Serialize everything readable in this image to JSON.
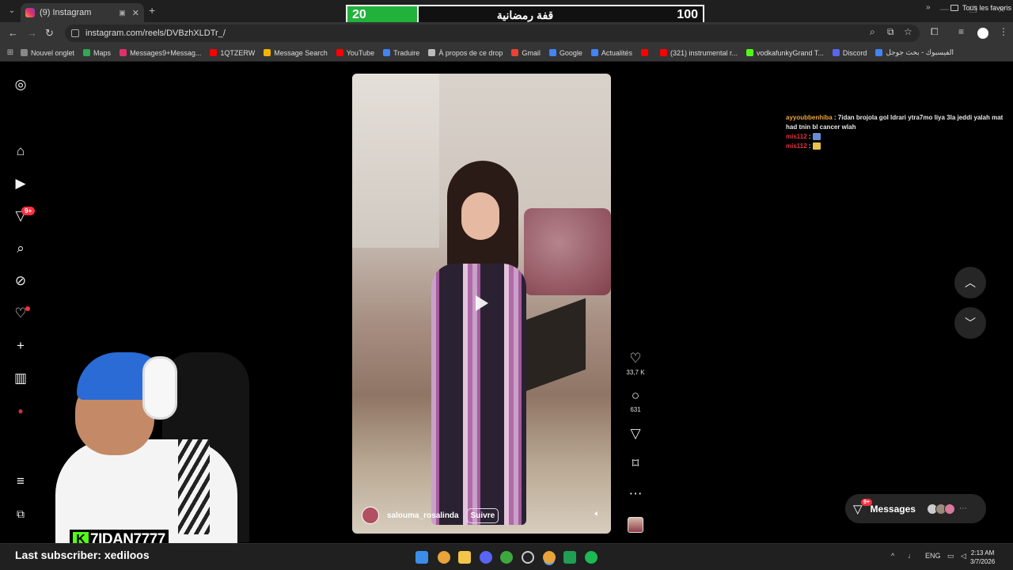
{
  "browser": {
    "tab": {
      "title": "(9) Instagram"
    },
    "url": "instagram.com/reels/DVBzhXLDTr_/",
    "bookmarks": [
      {
        "label": "Nouvel onglet",
        "icon": "blank-icon",
        "color": "#888888"
      },
      {
        "label": "Maps",
        "icon": "maps-icon",
        "color": "#34a853"
      },
      {
        "label": "Messages9+Messag...",
        "icon": "instagram-icon",
        "color": "#e1306c"
      },
      {
        "label": "1QTZERW",
        "icon": "youtube-icon",
        "color": "#ff0000"
      },
      {
        "label": "Message Search",
        "icon": "chart-icon",
        "color": "#f4b400"
      },
      {
        "label": "YouTube",
        "icon": "youtube-icon",
        "color": "#ff0000"
      },
      {
        "label": "Traduire",
        "icon": "translate-icon",
        "color": "#4285f4"
      },
      {
        "label": "À propos de ce drop",
        "icon": "globe-icon",
        "color": "#bbbbbb"
      },
      {
        "label": "Gmail",
        "icon": "gmail-icon",
        "color": "#ea4335"
      },
      {
        "label": "Google",
        "icon": "google-icon",
        "color": "#4285f4"
      },
      {
        "label": "Actualités",
        "icon": "news-icon",
        "color": "#4285f4"
      },
      {
        "label": "",
        "icon": "youtube-icon",
        "color": "#ff0000"
      },
      {
        "label": "(321) instrumental r...",
        "icon": "youtube-icon",
        "color": "#ff0000"
      },
      {
        "label": "vodkafunkyGrand T...",
        "icon": "kick-icon",
        "color": "#53fc18"
      },
      {
        "label": "Discord",
        "icon": "discord-icon",
        "color": "#5865f2"
      },
      {
        "label": "الفيسبوك - بحث جوجل",
        "icon": "google-icon",
        "color": "#4285f4"
      }
    ],
    "all_bookmarks": "Tous les favoris"
  },
  "score_overlay": {
    "current": "20",
    "title": "قفة رمضانية",
    "max": "100",
    "progress_fraction": 0.2,
    "fill_color": "#21b23c"
  },
  "sidebar": {
    "notifications_badge": "9+"
  },
  "reel": {
    "username": "salouma_rosalinda",
    "follow_label": "Suivre",
    "likes": "33,7 K",
    "comments": "631"
  },
  "chat": [
    {
      "user": "ayyoubbenhiba",
      "message": " : 7idan brojola gol ldrari ytra7mo liya 3la jeddi yalah mat had tnin bl cancer wlah",
      "user_color": "#f0a53a"
    },
    {
      "user": "mis112",
      "message": " : ",
      "user_color": "#e0343d",
      "emote_color": "#6a8bd1"
    },
    {
      "user": "mis112",
      "message": " : ",
      "user_color": "#e0343d",
      "emote_color": "#e7c34a"
    }
  ],
  "messages_pill": {
    "label": "Messages",
    "badge": "9+"
  },
  "stream": {
    "channel": "7IDAN7777",
    "last_subscriber": "Last subscriber: xediloos"
  },
  "taskbar": {
    "language": "ENG",
    "time": "2:13 AM",
    "date": "3/7/2026"
  }
}
